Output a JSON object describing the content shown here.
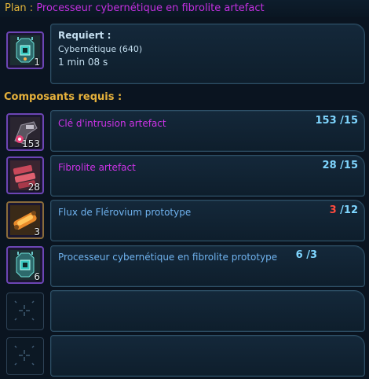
{
  "title": {
    "label": "Plan :",
    "name": "Processeur cybernétique en fibrolite artefact"
  },
  "plan": {
    "icon": "cybernetic-processor-icon",
    "count": "1",
    "requires_label": "Requiert :",
    "skill": "Cybernétique (640)",
    "time": "1 min 08 s"
  },
  "components_title": "Composants requis :",
  "components": [
    {
      "name": "Clé d'intrusion artefact",
      "owned": "153",
      "sep": "/",
      "required": "15",
      "count": "153",
      "icon": "intrusion-key-icon",
      "color": "purple"
    },
    {
      "name": "Fibrolite artefact",
      "owned": "28",
      "sep": "/",
      "required": "15",
      "count": "28",
      "icon": "fibrolite-icon",
      "color": "purple"
    },
    {
      "name": "Flux de Flérovium prototype",
      "owned": "3",
      "sep": "/",
      "required": "12",
      "count": "3",
      "icon": "flerovium-flux-icon",
      "color": "blue"
    },
    {
      "name": "Processeur cybernétique en fibrolite prototype",
      "owned": "6",
      "sep": "/",
      "required": "3",
      "count": "6",
      "icon": "cybernetic-processor-icon",
      "color": "blue"
    }
  ],
  "colors": {
    "title_label": "#e0b33a",
    "artefact_purple": "#cc33e6",
    "prototype_blue": "#6fb2ee",
    "qty_ok": "#7fd6ff",
    "qty_lacking": "#ff4a3d"
  }
}
